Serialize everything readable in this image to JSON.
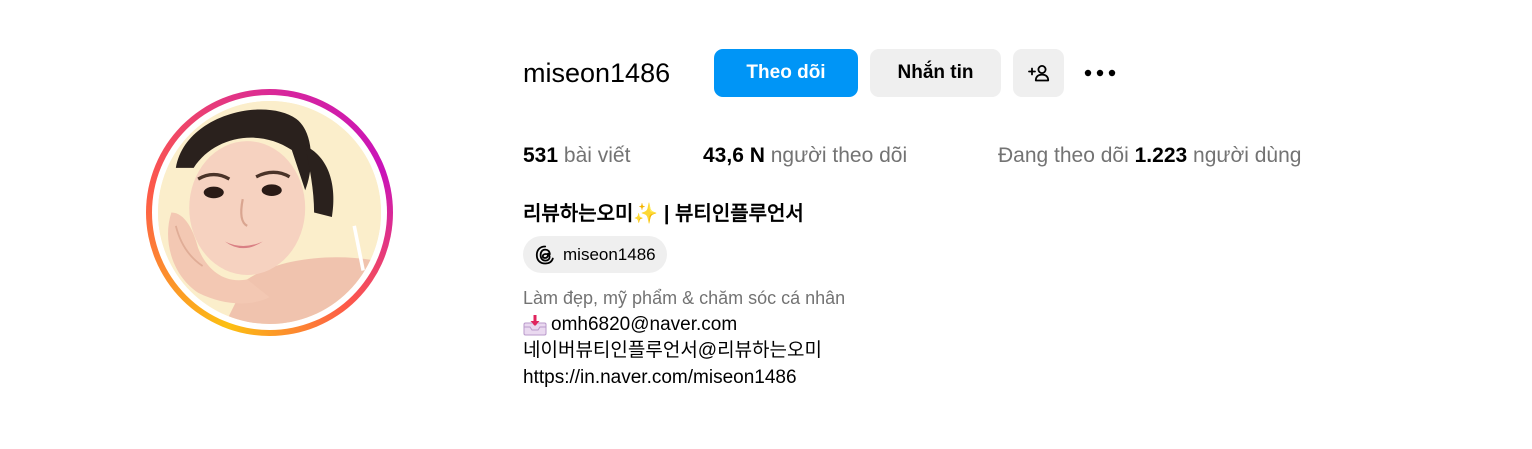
{
  "profile": {
    "username": "miseon1486",
    "follow_label": "Theo dõi",
    "message_label": "Nhắn tin",
    "suggest_icon": "add-person-icon",
    "more_icon": "more-horizontal-icon"
  },
  "stats": {
    "posts_count": "531",
    "posts_label": "bài viết",
    "followers_count": "43,6 N",
    "followers_label": "người theo dõi",
    "following_prefix": "Đang theo dõi",
    "following_count": "1.223",
    "following_suffix": "người dùng"
  },
  "bio": {
    "fullname_part1": "리뷰하는오미",
    "fullname_sparkle": "✨",
    "fullname_part2": "| 뷰티인플루언서",
    "threads_handle": "miseon1486",
    "category": "Làm đẹp, mỹ phẩm & chăm sóc cá nhân",
    "email": "omh6820@naver.com",
    "naver_line": "네이버뷰티인플루언서@리뷰하는오미",
    "link": "https://in.naver.com/miseon1486"
  },
  "colors": {
    "primary_button": "#0095f6",
    "secondary_button": "#efefef",
    "muted_text": "#737373",
    "ring_gradient": [
      "#fcc012",
      "#fd5949",
      "#d6249f",
      "#c913b9"
    ]
  }
}
